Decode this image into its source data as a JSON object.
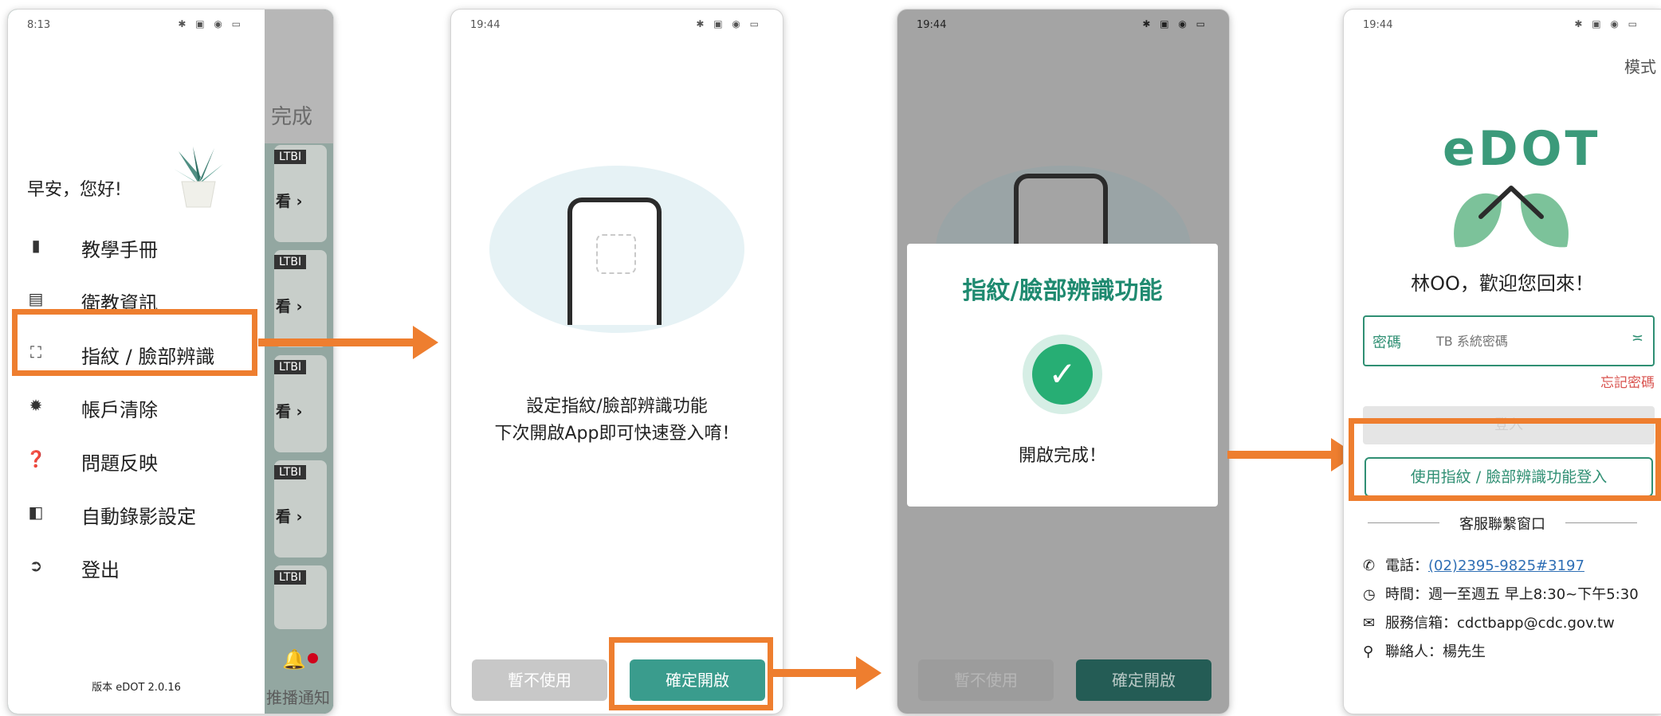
{
  "phone1": {
    "status_time": "8:13",
    "status_icons": "✱ ▣ ◉ ▭",
    "background": {
      "done_label": "完成",
      "tags": [
        "LTBI",
        "LTBI",
        "LTBI",
        "LTBI",
        "LTBI"
      ],
      "look_labels": [
        "看 ›",
        "看 ›",
        "看 ›",
        "看 ›"
      ],
      "notice_label": "推播通知"
    },
    "greeting": "早安，您好!",
    "menu": [
      {
        "icon": "book-icon",
        "glyph": "▮",
        "label": "教學手冊"
      },
      {
        "icon": "info-icon",
        "glyph": "▤",
        "label": "衛教資訊"
      },
      {
        "icon": "face-scan-icon",
        "glyph": "⛶",
        "label": "指紋 / 臉部辨識"
      },
      {
        "icon": "gear-icon",
        "glyph": "✹",
        "label": "帳戶清除"
      },
      {
        "icon": "question-icon",
        "glyph": "❓",
        "label": "問題反映"
      },
      {
        "icon": "camera-icon",
        "glyph": "◧",
        "label": "自動錄影設定"
      },
      {
        "icon": "logout-icon",
        "glyph": "➲",
        "label": "登出"
      }
    ],
    "version": "版本 eDOT 2.0.16"
  },
  "phone2": {
    "status_time": "19:44",
    "status_icons": "✱ ▣ ◉ ▭",
    "message_line1": "設定指紋/臉部辨識功能",
    "message_line2": "下次開啟App即可快速登入唷！",
    "later_button": "暫不使用",
    "confirm_button": "確定開啟"
  },
  "phone3": {
    "status_time": "19:44",
    "status_icons": "✱ ▣ ◉ ▭",
    "dialog_title": "指紋/臉部辨識功能",
    "check_glyph": "✓",
    "dialog_message": "開啟完成！",
    "later_button": "暫不使用",
    "confirm_button": "確定開啟"
  },
  "phone4": {
    "status_time": "19:44",
    "status_icons": "✱ ▣ ◉ ▭",
    "mode_label": "模式",
    "logo_text": "eDOT",
    "welcome": "林OO，歡迎您回來！",
    "password_label": "密碼",
    "password_placeholder": "TB 系統密碼",
    "eye_glyph": "≍",
    "forgot_password": "忘記密碼",
    "login_button": "登入",
    "biometric_button": "使用指紋 / 臉部辨識功能登入",
    "service_title": "客服聯繫窗口",
    "phone_label": "電話：",
    "phone_number": "(02)2395-9825#3197",
    "hours": "時間：週一至週五 早上8:30~下午5:30",
    "email": "服務信箱：cdctbapp@cdc.gov.tw",
    "contact": "聯絡人：楊先生"
  },
  "colors": {
    "highlight": "#ee7e2f",
    "brand_green": "#2f8f73",
    "button_teal": "#3a9c8d"
  }
}
